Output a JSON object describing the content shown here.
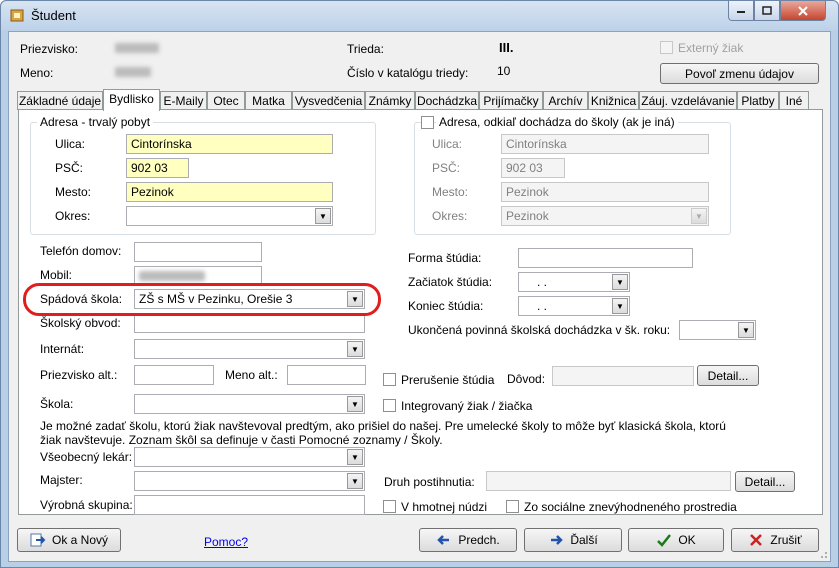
{
  "window": {
    "title": "Študent"
  },
  "header": {
    "surname_label": "Priezvisko:",
    "name_label": "Meno:",
    "class_label": "Trieda:",
    "class_value": "III.",
    "catalog_label": "Číslo v katalógu triedy:",
    "catalog_value": "10",
    "external_label": "Externý žiak",
    "allow_change_button": "Povoľ zmenu údajov"
  },
  "tabs": [
    {
      "label": "Základné údaje"
    },
    {
      "label": "Bydlisko"
    },
    {
      "label": "E-Maily"
    },
    {
      "label": "Otec"
    },
    {
      "label": "Matka"
    },
    {
      "label": "Vysvedčenia"
    },
    {
      "label": "Známky"
    },
    {
      "label": "Dochádzka"
    },
    {
      "label": "Prijímačky"
    },
    {
      "label": "Archív"
    },
    {
      "label": "Knižnica"
    },
    {
      "label": "Záuj. vzdelávanie"
    },
    {
      "label": "Platby"
    },
    {
      "label": "Iné"
    }
  ],
  "permanent_address": {
    "group_title": "Adresa - trvalý pobyt",
    "street_label": "Ulica:",
    "street_value": "Cintorínska",
    "zip_label": "PSČ:",
    "zip_value": "902 03",
    "city_label": "Mesto:",
    "city_value": "Pezinok",
    "district_label": "Okres:",
    "district_value": ""
  },
  "school_address": {
    "group_title": "Adresa, odkiaľ dochádza do školy (ak je iná)",
    "street_label": "Ulica:",
    "street_value": "Cintorínska",
    "zip_label": "PSČ:",
    "zip_value": "902 03",
    "city_label": "Mesto:",
    "city_value": "Pezinok",
    "district_label": "Okres:",
    "district_value": "Pezinok"
  },
  "left_fields": {
    "phone_label": "Telefón domov:",
    "mobile_label": "Mobil:",
    "catchment_label": "Spádová škola:",
    "catchment_value": "ZŠ s MŠ v Pezinku, Orešie 3",
    "district_school_label": "Školský obvod:",
    "dorm_label": "Internát:",
    "alt_surname_label": "Priezvisko alt.:",
    "alt_name_label": "Meno alt.:",
    "school_label": "Škola:",
    "school_note": "Je možné zadať školu, ktorú žiak navštevoval predtým, ako prišiel do našej. Pre umelecké školy to môže byť klasická škola, ktorú žiak navštevuje. Zoznam škôl sa definuje v časti Pomocné zoznamy / Školy.",
    "doctor_label": "Všeobecný lekár:",
    "master_label": "Majster:",
    "production_group_label": "Výrobná skupina:"
  },
  "right_fields": {
    "study_form_label": "Forma štúdia:",
    "study_start_label": "Začiatok štúdia:",
    "study_start_value": ".   .",
    "study_end_label": "Koniec štúdia:",
    "study_end_value": ".   .",
    "compulsory_label": "Ukončená povinná školská dochádzka v šk. roku:",
    "interruption_label": "Prerušenie štúdia",
    "reason_label": "Dôvod:",
    "detail_button": "Detail...",
    "integrated_label": "Integrovaný žiak / žiačka",
    "disability_label": "Druh postihnutia:",
    "detail_button_2": "Detail...",
    "material_need_label": "V hmotnej núdzi",
    "disadvantaged_label": "Zo sociálne znevýhodneného prostredia"
  },
  "footer": {
    "ok_new_button": "Ok a Nový",
    "help_link": "Pomoc?",
    "prev_button": "Predch.",
    "next_button": "Ďalší",
    "ok_button": "OK",
    "cancel_button": "Zrušiť"
  }
}
